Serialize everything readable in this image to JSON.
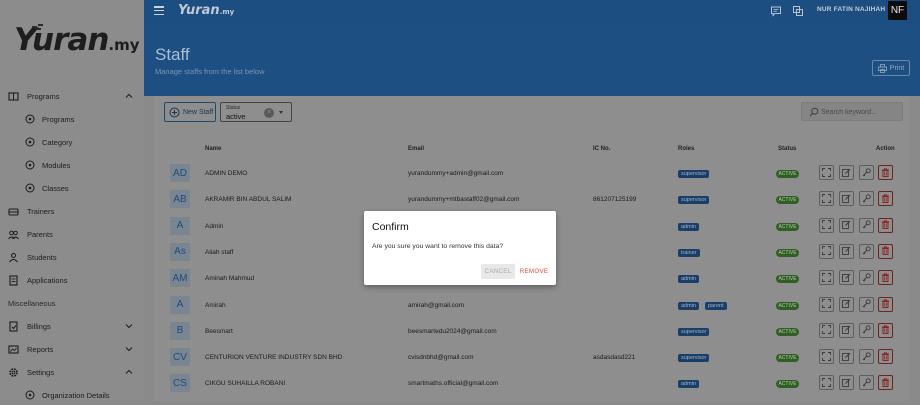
{
  "app": {
    "logo_main": "Yuran",
    "logo_suffix": ".my",
    "top_logo_main": "Yuran",
    "top_logo_suffix": ".my",
    "user_name": "NUR FATIN NAJIHAH",
    "avatar_initials": "NF"
  },
  "sidebar": {
    "items": [
      {
        "label": "Programs",
        "icon": "book-icon"
      },
      {
        "label": "Programs",
        "icon": "circle-plus-icon"
      },
      {
        "label": "Category",
        "icon": "circle-plus-icon"
      },
      {
        "label": "Modules",
        "icon": "circle-plus-icon"
      },
      {
        "label": "Classes",
        "icon": "circle-plus-icon"
      },
      {
        "label": "Trainers",
        "icon": "trainer-icon"
      },
      {
        "label": "Parents",
        "icon": "parents-icon"
      },
      {
        "label": "Students",
        "icon": "students-icon"
      },
      {
        "label": "Applications",
        "icon": "document-icon"
      }
    ],
    "section_label": "Miscellaneous",
    "misc_items": [
      {
        "label": "Billings",
        "icon": "billing-icon"
      },
      {
        "label": "Reports",
        "icon": "reports-icon"
      },
      {
        "label": "Settings",
        "icon": "gear-icon"
      },
      {
        "label": "Organization Details",
        "icon": "circle-plus-icon"
      }
    ]
  },
  "header": {
    "title": "Staff",
    "subtitle": "Manage staffs from the list below",
    "print_label": "Print"
  },
  "toolbar": {
    "new_staff_label": "New Staff",
    "status_label": "Status",
    "status_value": "active",
    "search_placeholder": "Search keyword..."
  },
  "table": {
    "columns": {
      "name": "Name",
      "email": "Email",
      "ic": "IC No.",
      "roles": "Roles",
      "status": "Status",
      "action": "Action"
    },
    "rows": [
      {
        "initials": "AD",
        "name": "ADMIN DEMO",
        "email": "yurandummy+admin@gmail.com",
        "ic": "",
        "roles": [
          "supervisor"
        ],
        "status": "ACTIVE"
      },
      {
        "initials": "AB",
        "name": "AKRAMIR BIN ABDUL SALIM",
        "email": "yurandummy+mtbastaff02@gmail.com",
        "ic": "861207125199",
        "roles": [
          "supervisor"
        ],
        "status": "ACTIVE"
      },
      {
        "initials": "A",
        "name": "Admin",
        "email": "",
        "ic": "",
        "roles": [
          "admin"
        ],
        "status": "ACTIVE"
      },
      {
        "initials": "As",
        "name": "Aliah staff",
        "email": "",
        "ic": "",
        "roles": [
          "trainer"
        ],
        "status": "ACTIVE"
      },
      {
        "initials": "AM",
        "name": "Aminah Mahmud",
        "email": "",
        "ic": "",
        "roles": [
          "admin"
        ],
        "status": "ACTIVE"
      },
      {
        "initials": "A",
        "name": "Amirah",
        "email": "amirah@gmail.com",
        "ic": "",
        "roles": [
          "admin",
          "parent"
        ],
        "status": "ACTIVE"
      },
      {
        "initials": "B",
        "name": "Beesmart",
        "email": "beesmartedu2024@gmail.com",
        "ic": "",
        "roles": [
          "supervisor"
        ],
        "status": "ACTIVE"
      },
      {
        "initials": "CV",
        "name": "CENTURION VENTURE INDUSTRY SDN BHD",
        "email": "cvisdnbhd@gmail.com",
        "ic": "asdasdasd221",
        "roles": [
          "supervisor"
        ],
        "status": "ACTIVE"
      },
      {
        "initials": "CS",
        "name": "CIKGU SUHAILLA ROBANI",
        "email": "smartmaths.official@gmail.com",
        "ic": "",
        "roles": [
          "admin"
        ],
        "status": "ACTIVE"
      }
    ],
    "action_icons": [
      "expand-icon",
      "edit-icon",
      "key-icon",
      "trash-icon"
    ]
  },
  "modal": {
    "title": "Confirm",
    "message": "Are you sure you want to remove this data?",
    "cancel_label": "CANCEL",
    "remove_label": "REMOVE"
  },
  "colors": {
    "primary": "#1d4f83",
    "danger": "#e54b3a",
    "active_badge": "#2f5f23"
  }
}
